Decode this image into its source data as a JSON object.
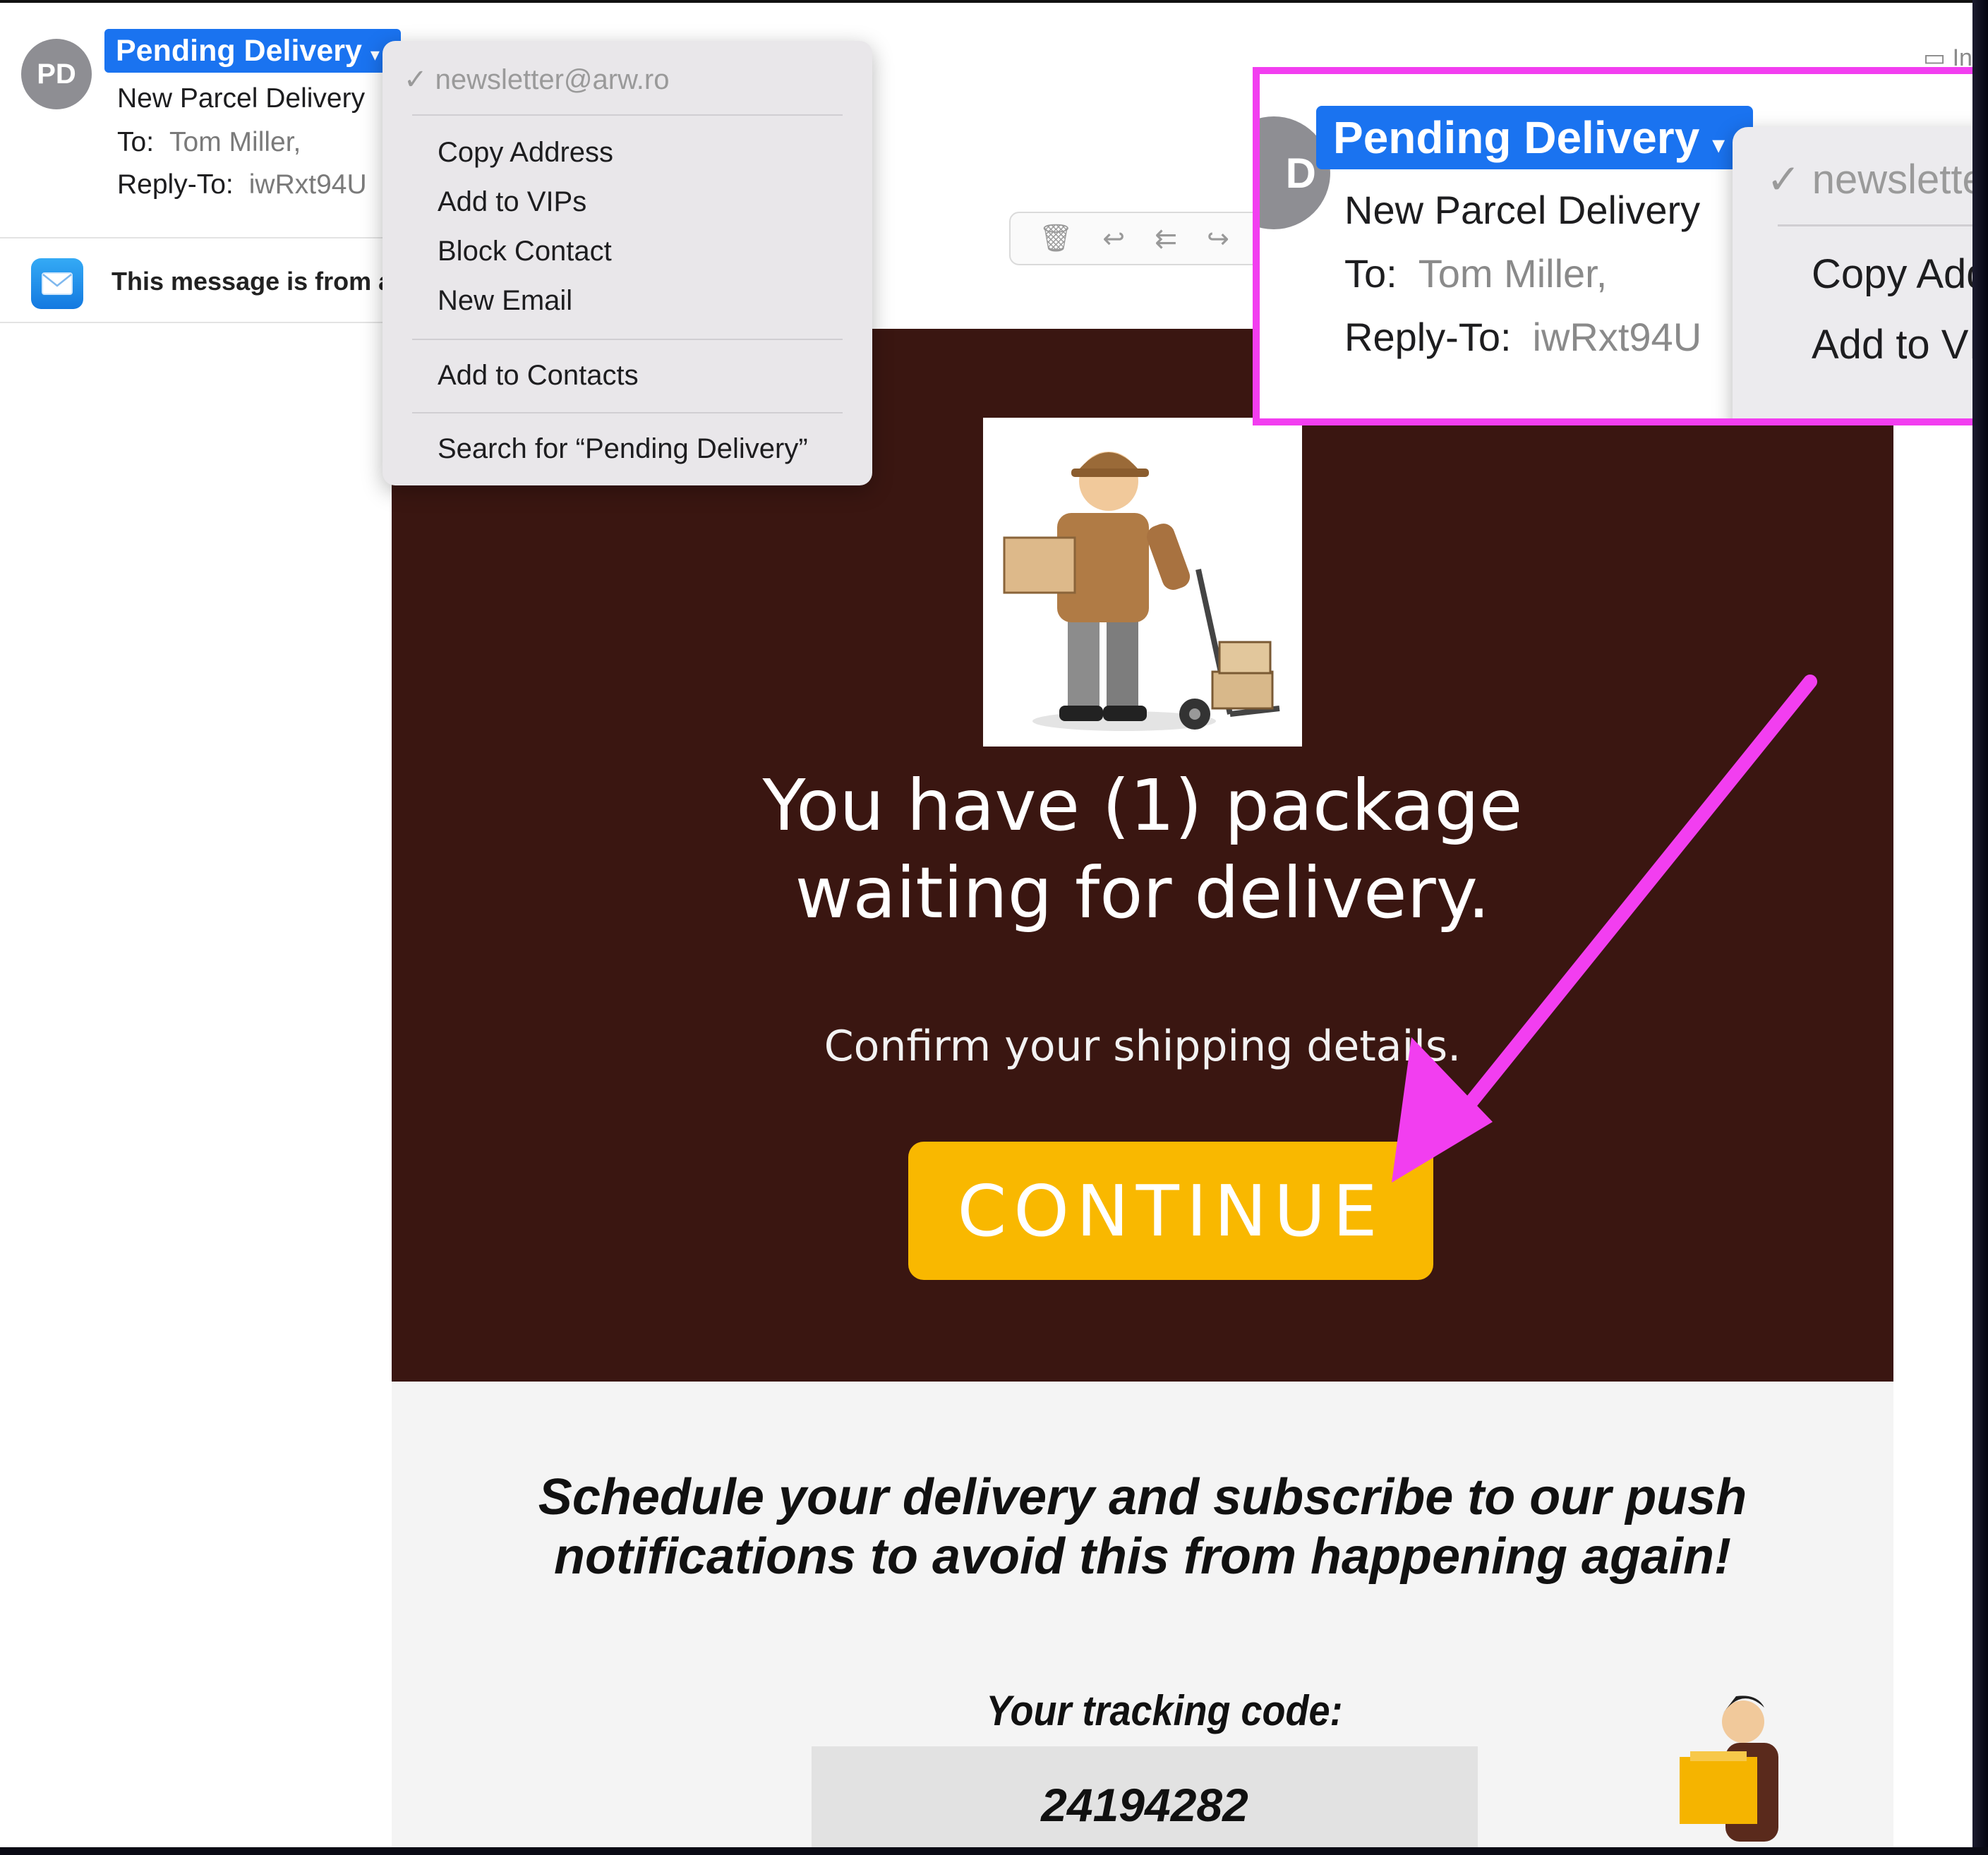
{
  "header": {
    "avatar_initials": "PD",
    "sender_name": "Pending Delivery",
    "subject": "New Parcel Delivery",
    "to_label": "To:",
    "to_value": "Tom Miller,",
    "reply_to_label": "Reply-To:",
    "reply_to_value": "iwRxt94U",
    "folder_label": "In"
  },
  "banner": {
    "text": "This message is from a"
  },
  "context_menu": {
    "header": "✓ newsletter@arw.ro",
    "items": [
      "Copy Address",
      "Add to VIPs",
      "Block Contact",
      "New Email",
      "Add to Contacts",
      "Search for “Pending Delivery”"
    ]
  },
  "callout": {
    "avatar_initials": "D",
    "sender_name": "Pending Delivery",
    "subject": "New Parcel Delivery",
    "to_label": "To:",
    "to_value": "Tom Miller,",
    "reply_to_label": "Reply-To:",
    "reply_to_value": "iwRxt94U",
    "menu_header": "✓ newslette",
    "menu_items": [
      "Copy Add",
      "Add to VI"
    ]
  },
  "email": {
    "headline_1": "You have (1) package",
    "headline_2": "waiting for delivery.",
    "subline": "Confirm your shipping details.",
    "cta": "CONTINUE",
    "schedule_1": "Schedule your delivery and subscribe to our push",
    "schedule_2": "notifications to avoid this from happening again!",
    "tracking_label": "Your tracking code:",
    "tracking_code": "24194282"
  },
  "colors": {
    "hero_bg": "#3a1611",
    "cta_bg": "#f9b800",
    "highlight": "#f23ef0",
    "sender_pill": "#1a73f0"
  },
  "icons": [
    "trash-icon",
    "reply-icon",
    "reply-all-icon",
    "forward-icon",
    "mail-app-icon",
    "folder-icon",
    "chevron-down-icon"
  ]
}
